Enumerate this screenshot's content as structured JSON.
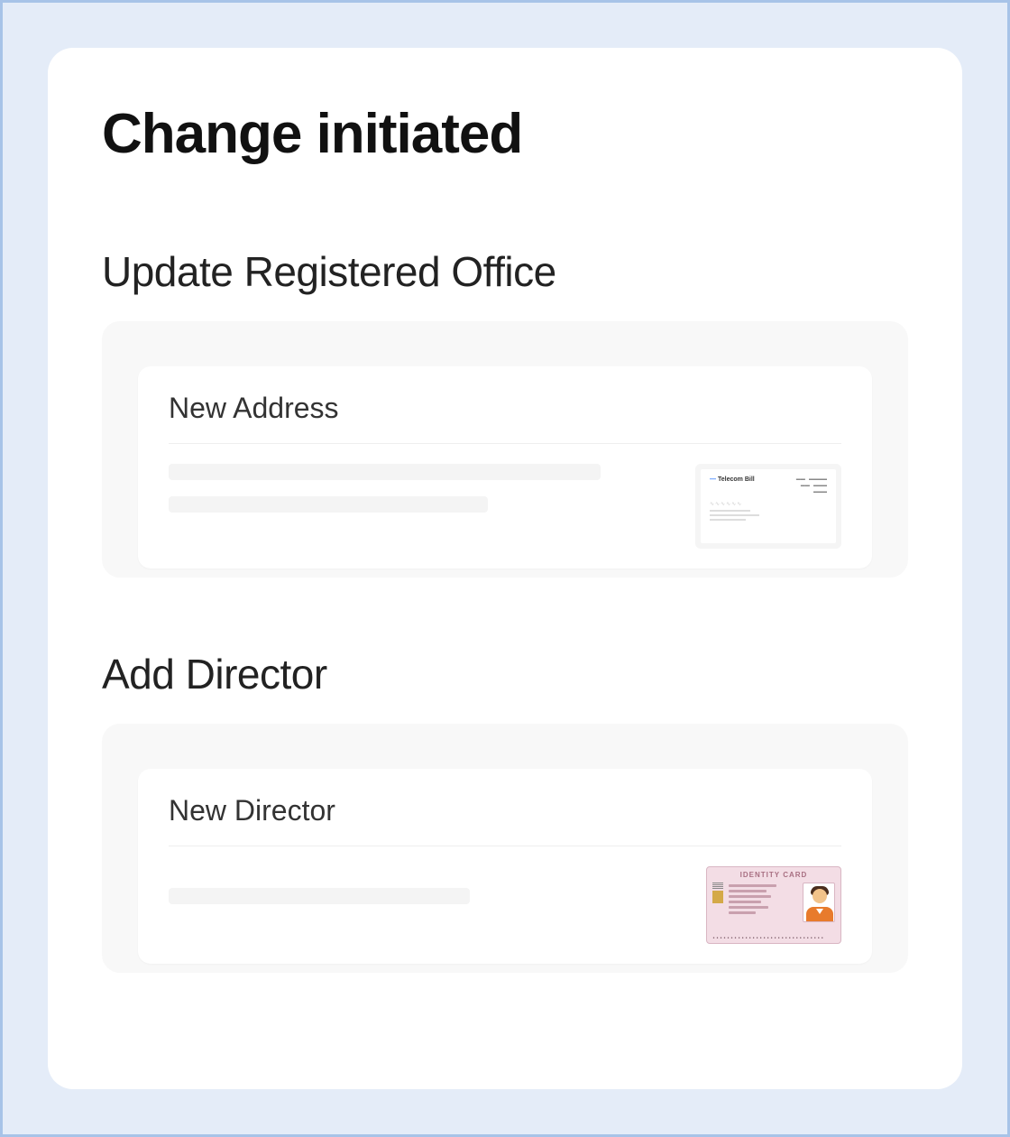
{
  "page": {
    "title": "Change initiated"
  },
  "sections": {
    "office": {
      "title": "Update Registered Office",
      "card_title": "New Address",
      "document": {
        "type": "telecom-bill",
        "brand_label": "Telecom Bill"
      }
    },
    "director": {
      "title": "Add Director",
      "card_title": "New Director",
      "document": {
        "type": "identity-card",
        "label": "IDENTITY CARD"
      }
    }
  }
}
